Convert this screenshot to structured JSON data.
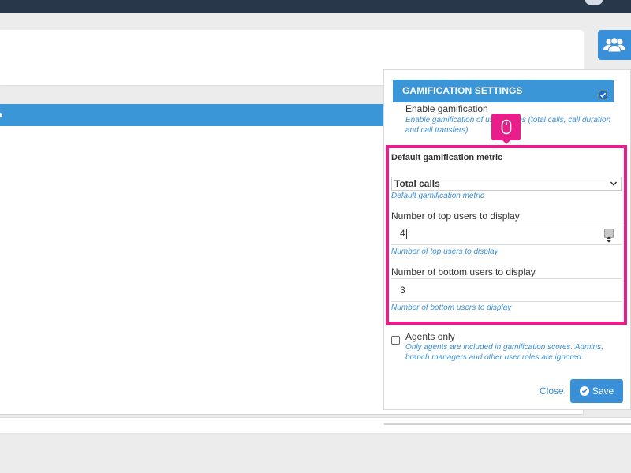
{
  "settings": {
    "header_title": "GAMIFICATION SETTINGS",
    "enable": {
      "title": "Enable gamification",
      "help": "Enable gamification of user scores (total calls, call duration and call transfers)"
    },
    "metric": {
      "title": "Default gamification metric",
      "selected": "Total calls",
      "help": "Default gamification metric"
    },
    "top_users": {
      "title": "Number of top users to display",
      "value": "4",
      "help": "Number of top users to display"
    },
    "bottom_users": {
      "title": "Number of bottom users to display",
      "value": "3",
      "help": "Number of bottom users to display"
    },
    "agents_only": {
      "title": "Agents only",
      "help": "Only agents are included in gamification scores. Admins, branch managers and other user roles are ignored."
    },
    "close_label": "Close",
    "save_label": "Save"
  },
  "icons": {
    "users": "users-icon",
    "mouse": "mouse-icon",
    "check": "check-circle-icon"
  },
  "colors": {
    "accent": "#3a96d6",
    "highlight": "#ea1e8a",
    "help_text": "#3a8fd4",
    "topbar": "#283749"
  }
}
